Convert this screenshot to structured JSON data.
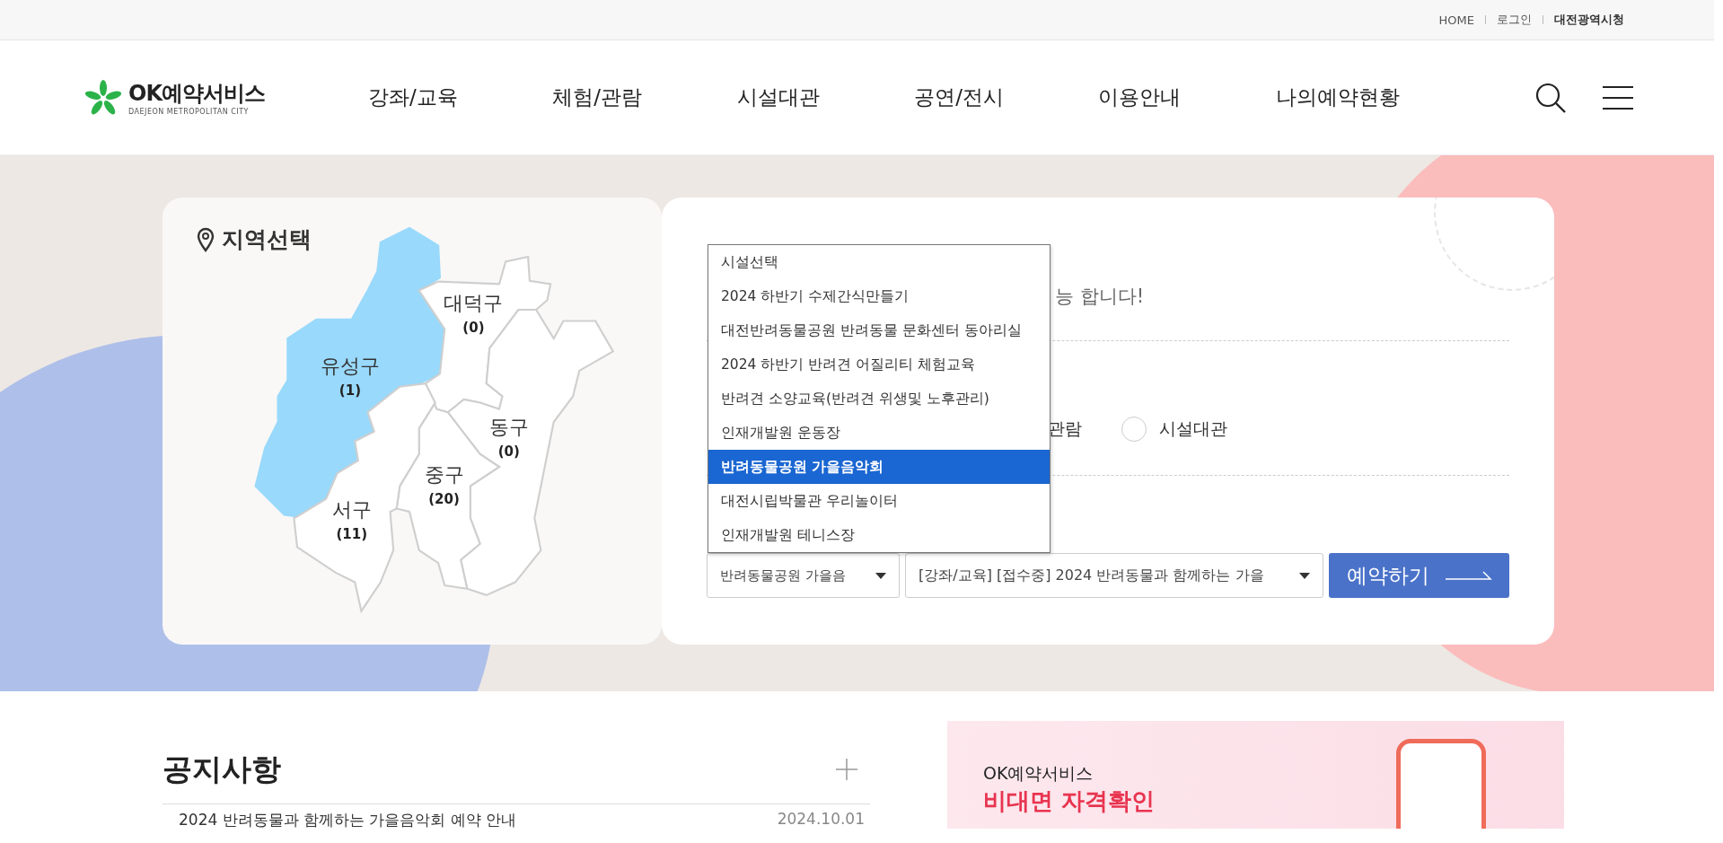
{
  "top_links": [
    {
      "label": "HOME",
      "bold": false
    },
    {
      "label": "로그인",
      "bold": false
    },
    {
      "label": "대전광역시청",
      "bold": true
    }
  ],
  "logo": {
    "title": "OK예약서비스",
    "subtitle": "DAEJEON METROPOLITAN CITY"
  },
  "nav": [
    "강좌/교육",
    "체험/관람",
    "시설대관",
    "공연/전시",
    "이용안내",
    "나의예약현황"
  ],
  "region_panel": {
    "title": "지역선택",
    "districts": [
      {
        "name": "유성구",
        "count": "(1)",
        "selected": true
      },
      {
        "name": "대덕구",
        "count": "(0)",
        "selected": false
      },
      {
        "name": "동구",
        "count": "(0)",
        "selected": false
      },
      {
        "name": "중구",
        "count": "(20)",
        "selected": false
      },
      {
        "name": "서구",
        "count": "(11)",
        "selected": false
      }
    ]
  },
  "reservation_panel": {
    "notice_fragment": "능 합니다!",
    "radios": [
      {
        "label": "관람",
        "selected": false,
        "circle_visible": false
      },
      {
        "label": "시설대관",
        "selected": false,
        "circle_visible": true
      }
    ],
    "facility_options": [
      {
        "label": "시설선택",
        "selected": false
      },
      {
        "label": "2024 하반기 수제간식만들기",
        "selected": false
      },
      {
        "label": "대전반려동물공원 반려동물 문화센터 동아리실",
        "selected": false
      },
      {
        "label": "2024 하반기 반려견 어질리티 체험교육",
        "selected": false
      },
      {
        "label": "반려견 소양교육(반려견 위생및 노후관리)",
        "selected": false
      },
      {
        "label": "인재개발원 운동장",
        "selected": false
      },
      {
        "label": "반려동물공원 가을음악회",
        "selected": true
      },
      {
        "label": "대전시립박물관 우리놀이터",
        "selected": false
      },
      {
        "label": "인재개발원 테니스장",
        "selected": false
      }
    ],
    "facility_select": "반려동물공원 가을음",
    "program_select": "[강좌/교육] [접수중] 2024 반려동물과 함께하는 가을",
    "reserve_button": "예약하기"
  },
  "notices": {
    "title": "공지사항",
    "items": [
      {
        "title": "2024 반려동물과 함께하는 가을음악회 예약 안내",
        "date": "2024.10.01"
      }
    ]
  },
  "banner": {
    "brand": "OK예약서비스",
    "headline": "비대면 자격확인"
  }
}
